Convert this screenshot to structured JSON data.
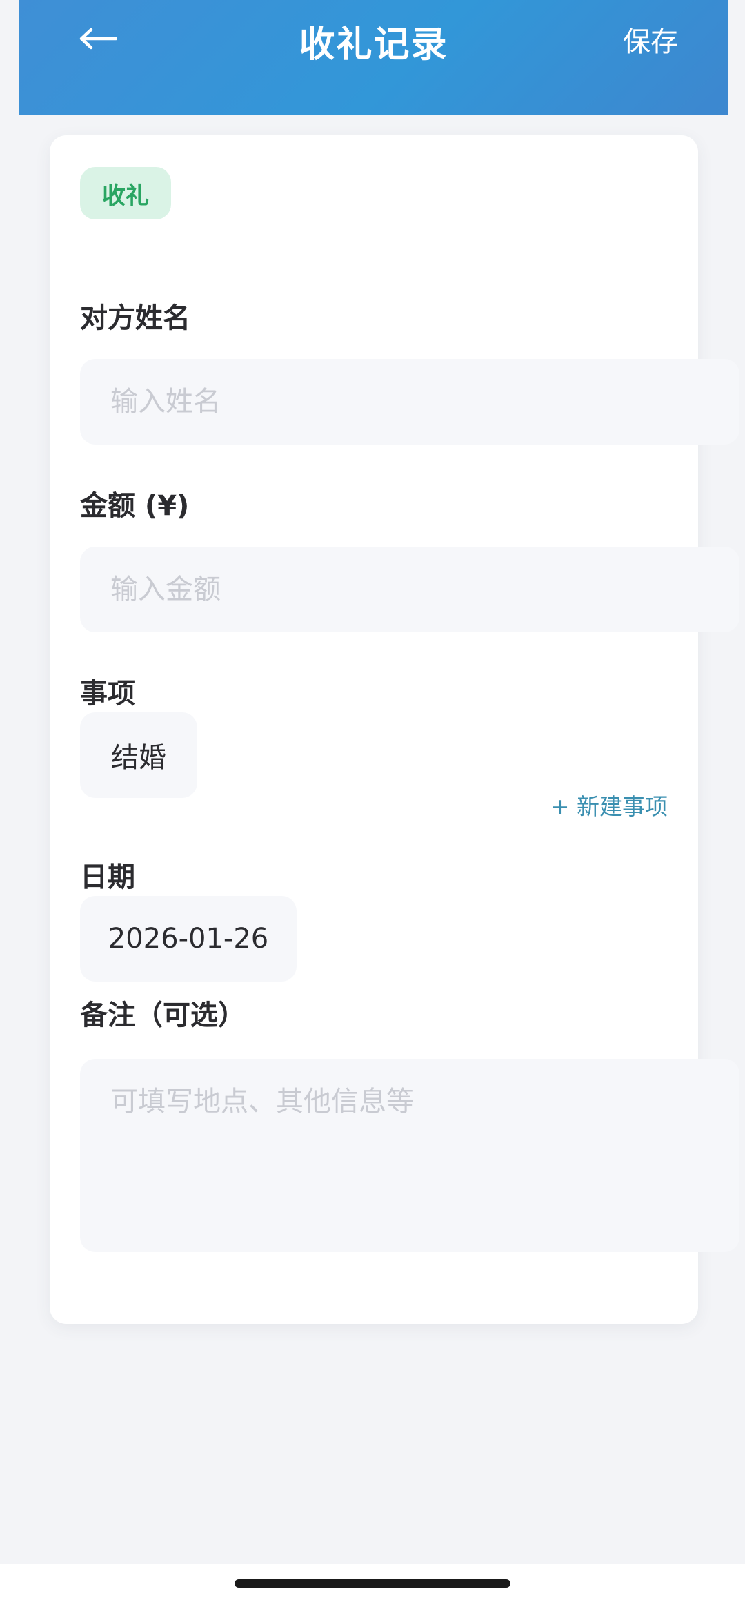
{
  "header": {
    "title": "收礼记录",
    "save_label": "保存",
    "back_icon": "arrow-left-icon"
  },
  "form": {
    "type_tag": "收礼",
    "name": {
      "label": "对方姓名",
      "placeholder": "输入姓名",
      "value": ""
    },
    "amount": {
      "label": "金额 (¥)",
      "placeholder": "输入金额",
      "value": ""
    },
    "event": {
      "label": "事项",
      "selected": "结婚",
      "new_link": "+ 新建事项"
    },
    "date": {
      "label": "日期",
      "value": "2026-01-26"
    },
    "note": {
      "label": "备注（可选）",
      "placeholder": "可填写地点、其他信息等",
      "value": ""
    }
  },
  "colors": {
    "header_bg": "#3297d8",
    "tag_bg": "#daf3e6",
    "tag_text": "#29a562",
    "link": "#3a8fb0",
    "field_bg": "#f6f7fa",
    "page_bg": "#f3f4f7"
  }
}
